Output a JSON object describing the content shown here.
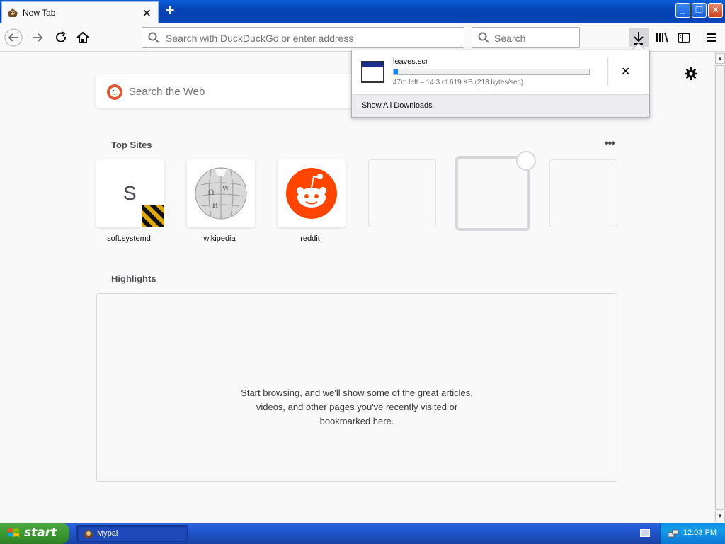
{
  "window": {
    "tab_title": "New Tab",
    "new_tab_label": "+",
    "close_tab_label": "✕"
  },
  "navbar": {
    "url_placeholder": "Search with DuckDuckGo or enter address",
    "search_placeholder": "Search"
  },
  "newtab": {
    "web_search_placeholder": "Search the Web",
    "top_sites_title": "Top Sites",
    "more_label": "•••",
    "tiles": [
      {
        "letter": "S",
        "label": "soft.systemd"
      },
      {
        "label": "wikipedia"
      },
      {
        "label": "reddit"
      }
    ],
    "highlights_title": "Highlights",
    "highlights_message_line1": "Start browsing, and we'll show some of the great articles,",
    "highlights_message_line2": "videos, and other pages you've recently visited or",
    "highlights_message_line3": "bookmarked here."
  },
  "downloads": {
    "filename": "leaves.scr",
    "status": "47m left – 14.3 of 619 KB (218 bytes/sec)",
    "progress_fraction": 0.023,
    "cancel_label": "✕",
    "show_all_label": "Show All Downloads"
  },
  "taskbar": {
    "start_label": "start",
    "task_label": "Mypal",
    "clock": "12:03 PM"
  },
  "colors": {
    "accent_blue": "#0a84ff",
    "reddit_orange": "#ff4500",
    "ddg_orange": "#de5833",
    "xp_green": "#3c9a32",
    "xp_blue": "#245edb"
  }
}
